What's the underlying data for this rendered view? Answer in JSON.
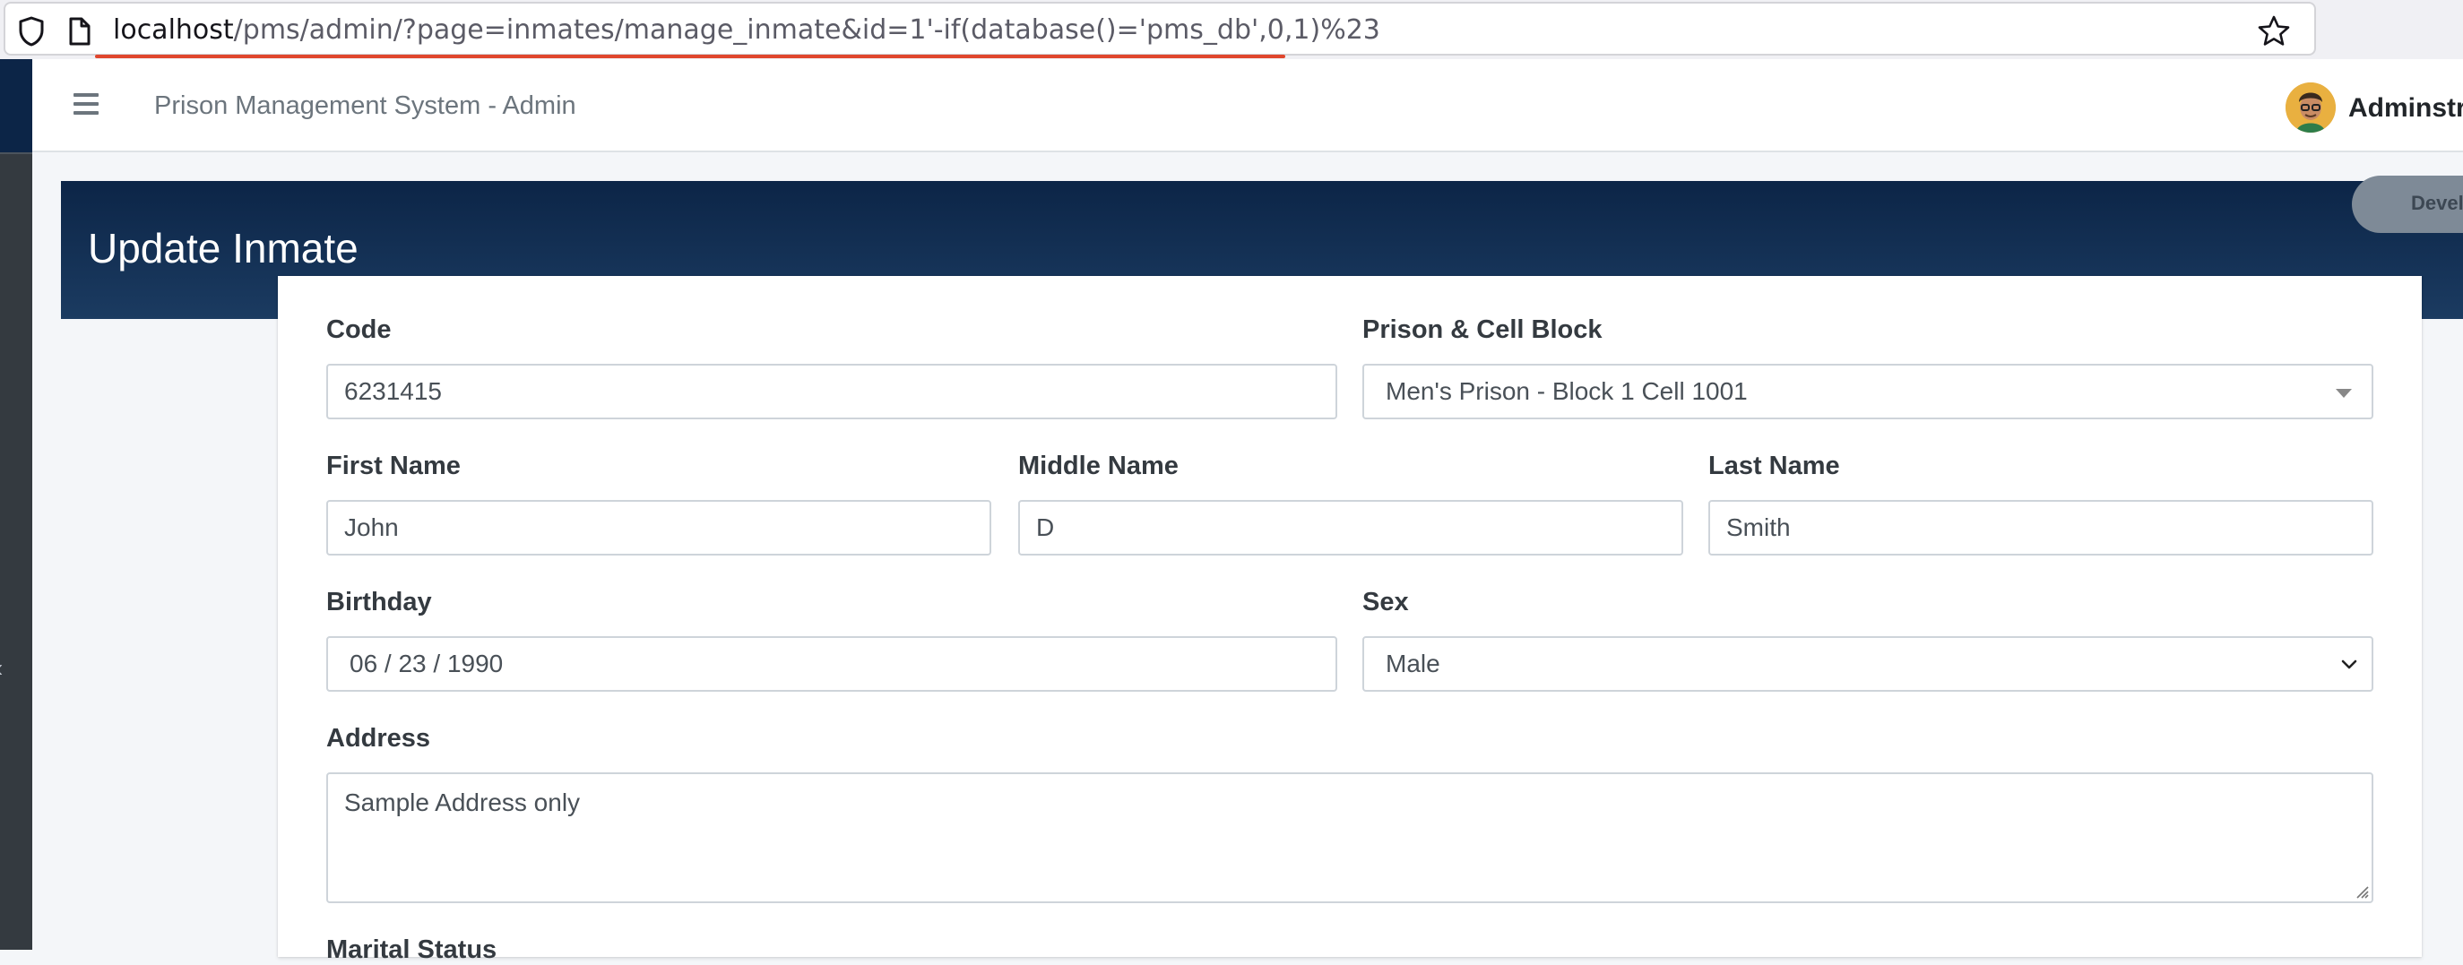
{
  "browser": {
    "url_host": "localhost",
    "url_path": "/pms/admin/?page=inmates/manage_inmate&id=1'-if(database()='pms_db',0,1)%23"
  },
  "navbar": {
    "title": "Prison Management System - Admin",
    "user_name": "Adminstrator"
  },
  "header": {
    "page_title": "Update Inmate",
    "badge_label": "Developer"
  },
  "form": {
    "code": {
      "label": "Code",
      "value": "6231415"
    },
    "cell_block": {
      "label": "Prison & Cell Block",
      "value": "Men's Prison - Block 1 Cell 1001"
    },
    "first_name": {
      "label": "First Name",
      "value": "John"
    },
    "middle_name": {
      "label": "Middle Name",
      "value": "D"
    },
    "last_name": {
      "label": "Last Name",
      "value": "Smith"
    },
    "birthday": {
      "label": "Birthday",
      "value": "06 / 23 / 1990"
    },
    "sex": {
      "label": "Sex",
      "value": "Male"
    },
    "address": {
      "label": "Address",
      "value": "Sample Address only"
    },
    "marital_status": {
      "label": "Marital Status"
    }
  },
  "icons": {
    "shield": "shield-icon",
    "page": "page-icon",
    "star": "bookmark-star-icon",
    "hamburger": "hamburger-menu-icon",
    "sidebar_toggle": "chevron-left-icon"
  }
}
